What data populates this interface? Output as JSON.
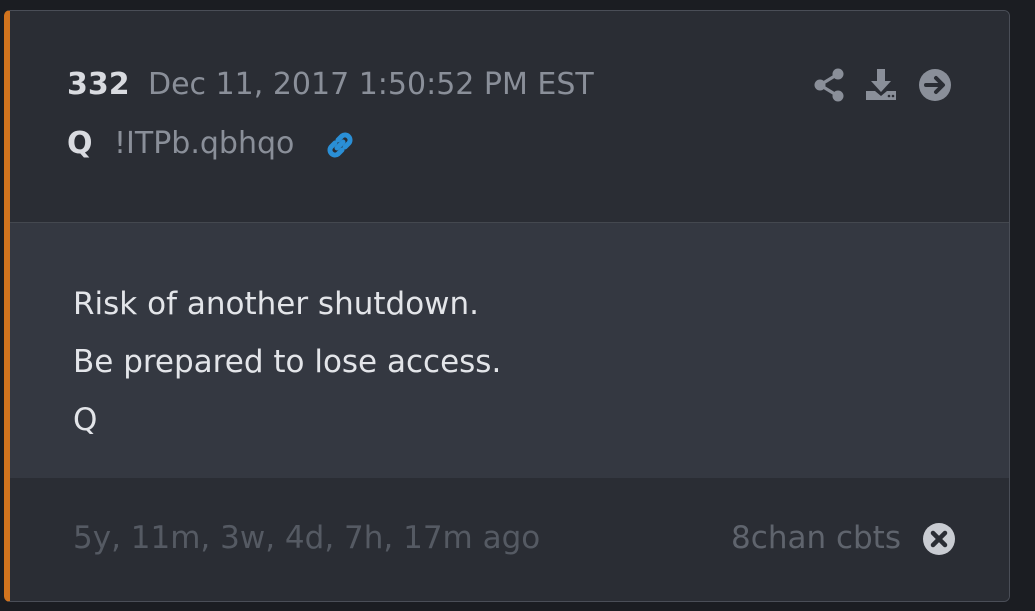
{
  "post": {
    "number": "332",
    "date": "Dec 11, 2017 1:50:52 PM EST",
    "author": "Q",
    "tripcode": "!ITPb.qbhqo"
  },
  "body": {
    "lines": [
      "Risk of another shutdown.",
      "Be prepared to lose access.",
      "Q"
    ]
  },
  "footer": {
    "ago": "5y, 11m, 3w, 4d, 7h, 17m ago",
    "source": "8chan cbts"
  },
  "icons": {
    "link": "link-icon",
    "share": "share-icon",
    "download": "download-icon",
    "forward": "arrow-right-circle-icon",
    "close": "close-circle-icon"
  },
  "colors": {
    "accent_border": "#d2741e",
    "link_blue": "#2a8fd6",
    "card_bg": "#2a2d34",
    "body_bg": "#343841"
  }
}
